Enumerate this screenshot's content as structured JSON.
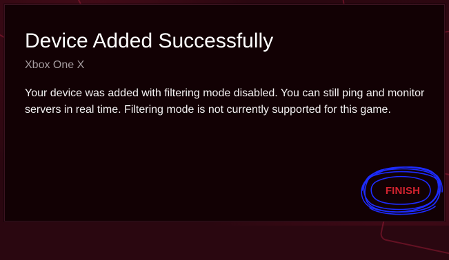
{
  "dialog": {
    "title": "Device Added Successfully",
    "subtitle": "Xbox One X",
    "message": "Your device was added with filtering mode disabled. You can still ping and monitor servers in real time. Filtering mode is not currently supported for this game.",
    "finish_label": "FINISH"
  },
  "colors": {
    "background": "#2a0710",
    "dialog_background": "#120104",
    "title_text": "#ffffff",
    "subtitle_text": "#a69da1",
    "body_text": "#f4f1f2",
    "accent": "#d3232f",
    "scribble": "#1d2cff"
  }
}
